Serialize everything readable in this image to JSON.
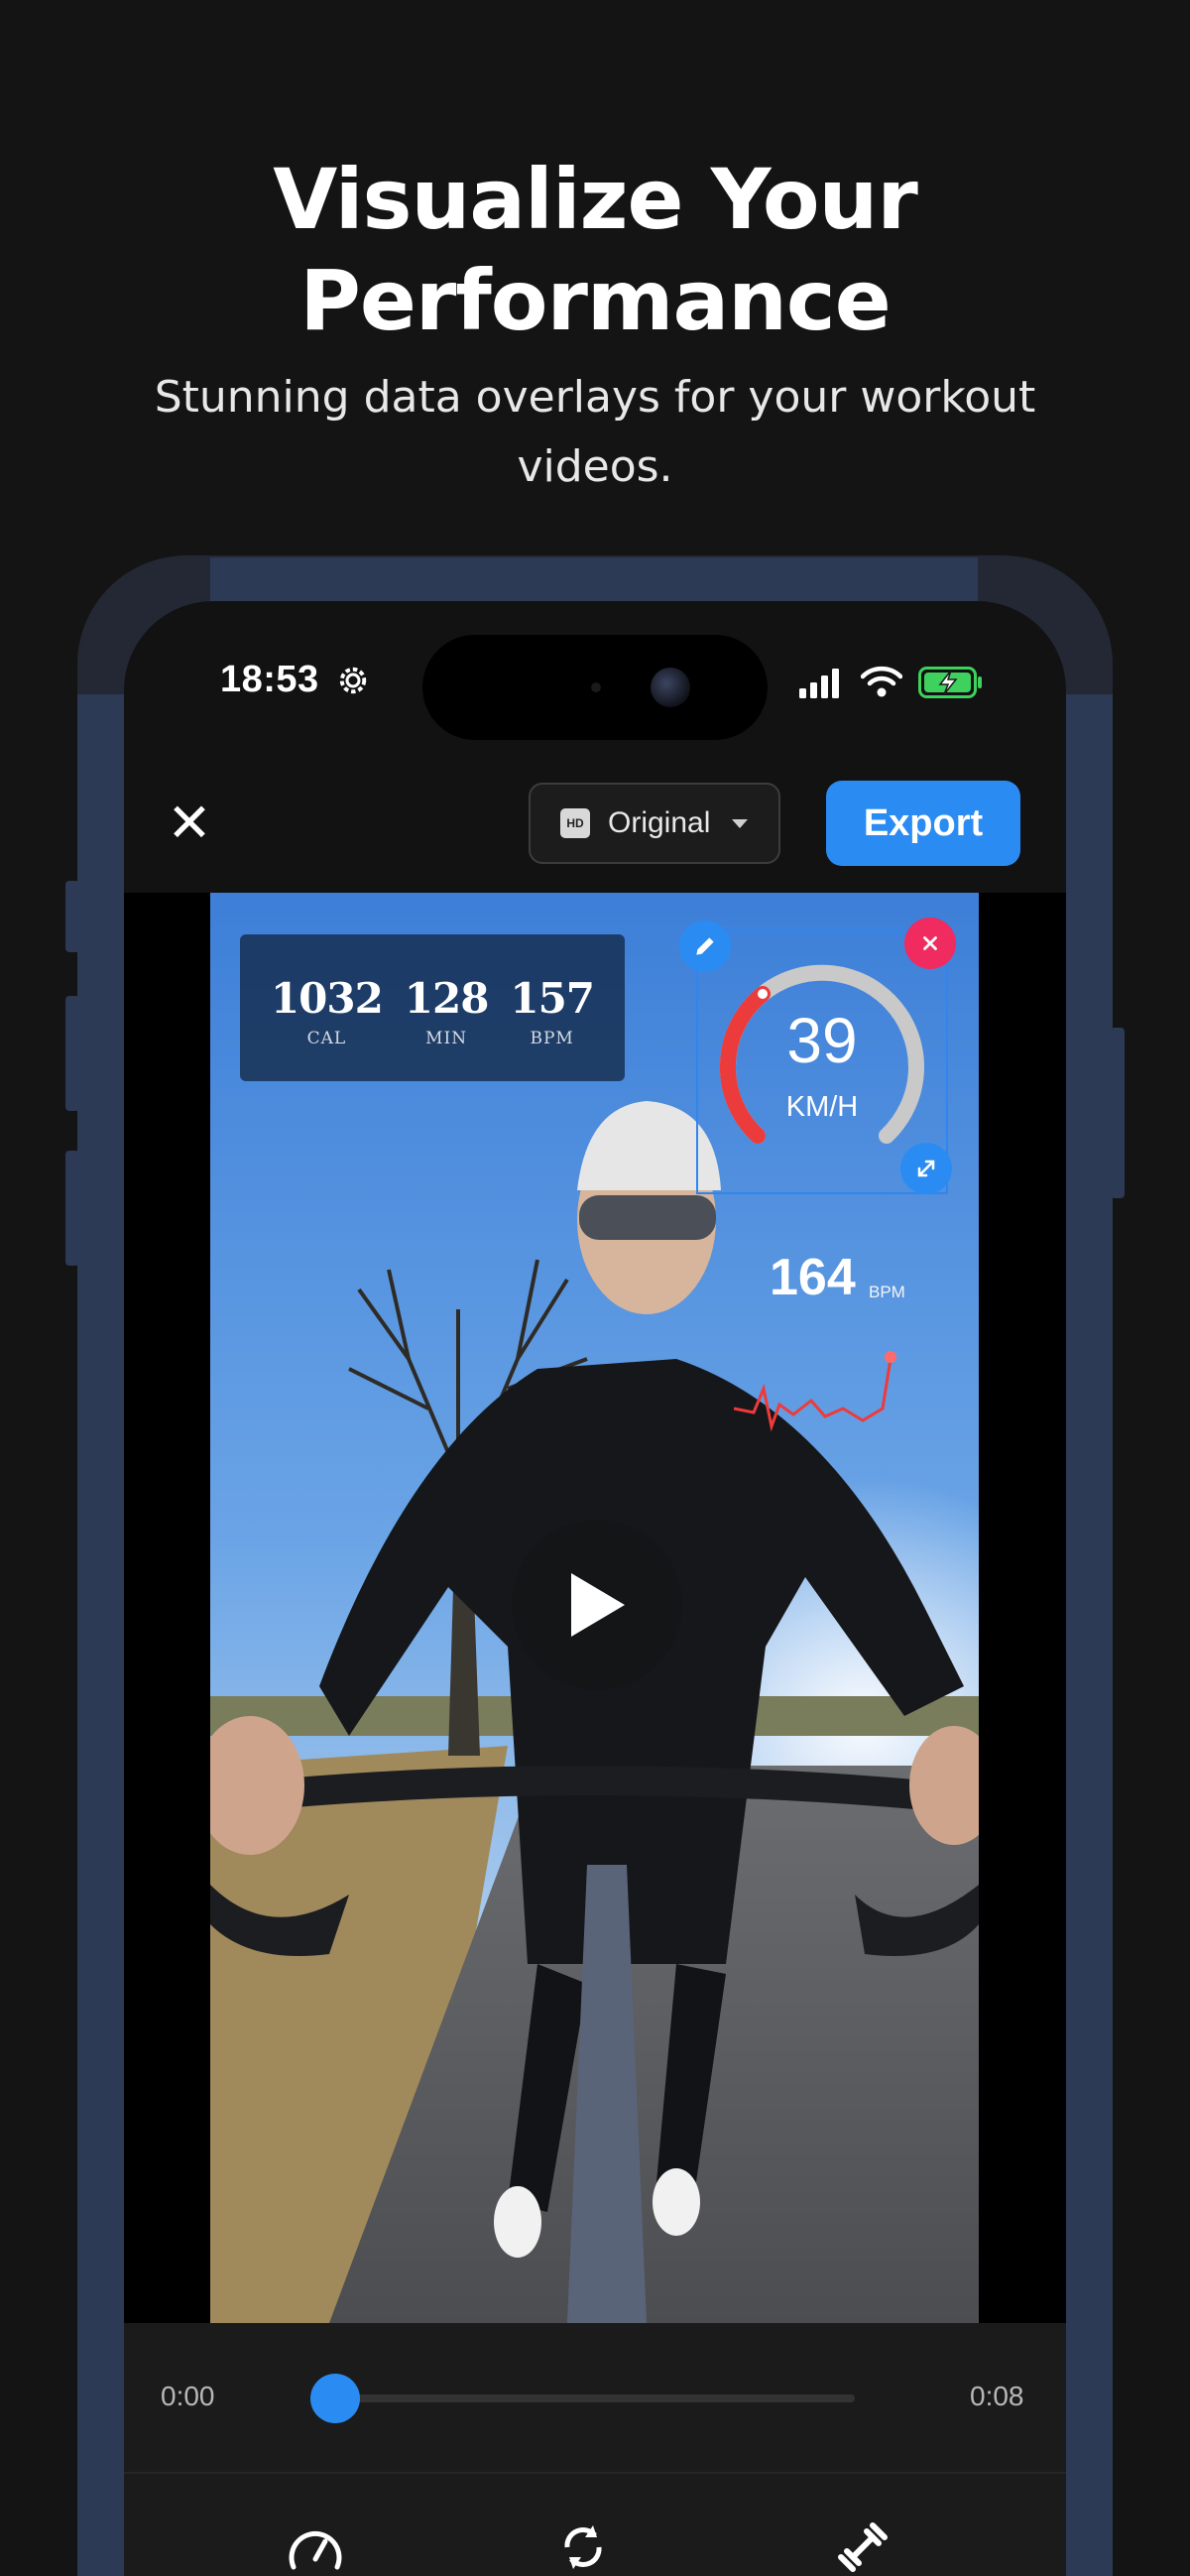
{
  "promo": {
    "title_line1": "Visualize Your",
    "title_line2": "Performance",
    "subtitle_line1": "Stunning data overlays for your workout",
    "subtitle_line2": "videos."
  },
  "status_bar": {
    "time": "18:53"
  },
  "toolbar": {
    "close_icon": "close-icon",
    "quality_badge": "HD",
    "quality_label": "Original",
    "export_label": "Export"
  },
  "overlays": {
    "stats": [
      {
        "value": "1032",
        "label": "CAL"
      },
      {
        "value": "128",
        "label": "MIN"
      },
      {
        "value": "157",
        "label": "BPM"
      }
    ],
    "speed": {
      "value": "39",
      "unit": "KM/H"
    },
    "heart": {
      "value": "164",
      "unit": "BPM"
    }
  },
  "timeline": {
    "start": "0:00",
    "end": "0:08",
    "progress": 0.0
  },
  "colors": {
    "accent": "#2a8cf2",
    "gauge_red": "#ec3b3b",
    "delete": "#ef2b5f"
  },
  "bottom_tools": [
    "speedometer-icon",
    "sync-icon",
    "dumbbell-icon"
  ]
}
